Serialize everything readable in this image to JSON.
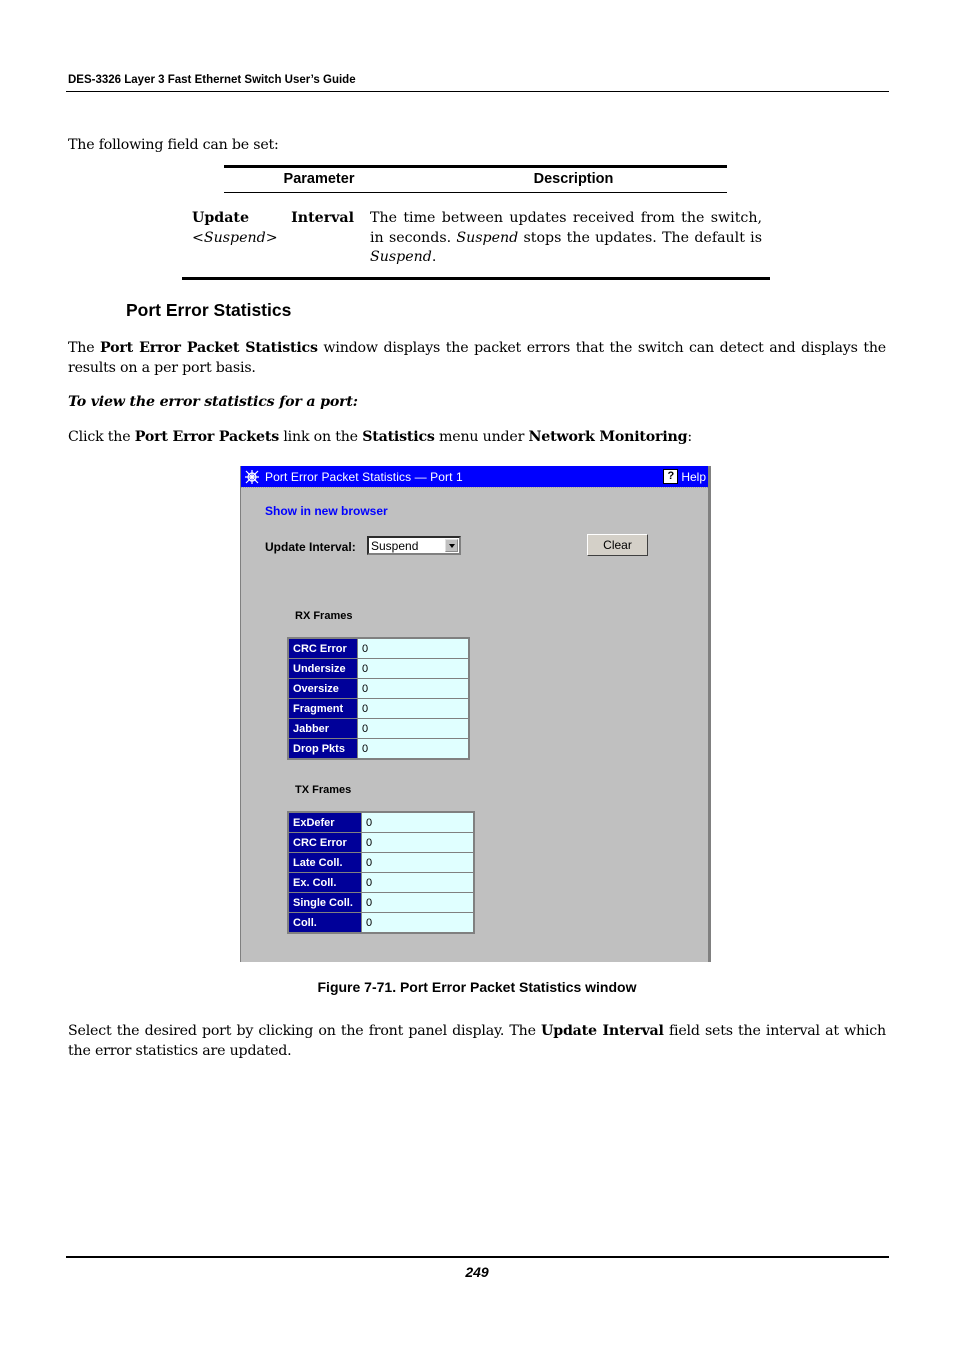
{
  "header": {
    "title": "DES-3326 Layer 3 Fast Ethernet Switch User’s Guide"
  },
  "intro": "The following field can be set:",
  "param_table": {
    "headers": [
      "Parameter",
      "Description"
    ],
    "rows": [
      {
        "param_word1": "Update",
        "param_word2": "Interval",
        "param_default_open": "<",
        "param_default": "Suspend",
        "param_default_close": ">",
        "desc_part1": "The time between updates received from the switch, in seconds. ",
        "desc_italic1": "Suspend",
        "desc_part2": " stops the updates. The default is ",
        "desc_italic2": "Suspend",
        "desc_part3": "."
      }
    ]
  },
  "section": {
    "heading": "Port Error Statistics",
    "para1": {
      "pre": "The ",
      "bold": "Port Error Packet Statistics",
      "post": " window displays the packet errors that the switch can detect and displays the results on a per port basis."
    },
    "procedure": "To view the error statistics for a port:",
    "para2": {
      "t1": "Click the ",
      "b1": "Port Error Packets",
      "t2": " link on the ",
      "b2": "Statistics",
      "t3": " menu under ",
      "b3": "Network Monitoring",
      "t4": ":"
    }
  },
  "window": {
    "title": "Port Error Packet Statistics — Port 1",
    "help_label": "Help",
    "help_icon_glyph": "?",
    "show_new_browser": "Show in new browser",
    "update_interval_label": "Update Interval:",
    "update_interval_value": "Suspend",
    "clear_label": "Clear",
    "rx": {
      "label": "RX Frames",
      "rows": [
        {
          "name": "CRC Error",
          "value": "0"
        },
        {
          "name": "Undersize",
          "value": "0"
        },
        {
          "name": "Oversize",
          "value": "0"
        },
        {
          "name": "Fragment",
          "value": "0"
        },
        {
          "name": "Jabber",
          "value": "0"
        },
        {
          "name": "Drop Pkts",
          "value": "0"
        }
      ]
    },
    "tx": {
      "label": "TX Frames",
      "rows": [
        {
          "name": "ExDefer",
          "value": "0"
        },
        {
          "name": "CRC Error",
          "value": "0"
        },
        {
          "name": "Late Coll.",
          "value": "0"
        },
        {
          "name": "Ex. Coll.",
          "value": "0"
        },
        {
          "name": "Single Coll.",
          "value": "0"
        },
        {
          "name": "Coll.",
          "value": "0"
        }
      ]
    },
    "colors": {
      "titlebar": "#0000ff",
      "label_cell": "#000099",
      "value_cell": "#e0ffff",
      "background": "#c0c0c0"
    }
  },
  "figure_caption": "Figure 7-71.  Port Error Packet Statistics window",
  "para3": {
    "t1": "Select the desired port by clicking on the front panel display. The ",
    "b1": "Update Interval",
    "t2": " field sets the interval at which the error statistics are updated."
  },
  "footer": {
    "page_number": "249"
  }
}
